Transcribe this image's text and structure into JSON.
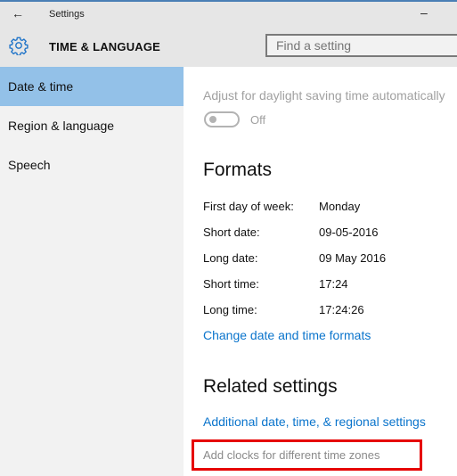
{
  "window": {
    "back_icon": "←",
    "title": "Settings",
    "minimize_icon": "–"
  },
  "header": {
    "section_title": "TIME & LANGUAGE",
    "search_placeholder": "Find a setting",
    "search_value": ""
  },
  "sidebar": {
    "items": [
      {
        "label": "Date & time",
        "active": true
      },
      {
        "label": "Region & language",
        "active": false
      },
      {
        "label": "Speech",
        "active": false
      }
    ]
  },
  "content": {
    "daylight_saving": {
      "label": "Adjust for daylight saving time automatically",
      "state": "Off"
    },
    "formats": {
      "heading": "Formats",
      "rows": [
        {
          "label": "First day of week:",
          "value": "Monday"
        },
        {
          "label": "Short date:",
          "value": "09-05-2016"
        },
        {
          "label": "Long date:",
          "value": "09 May 2016"
        },
        {
          "label": "Short time:",
          "value": "17:24"
        },
        {
          "label": "Long time:",
          "value": "17:24:26"
        }
      ],
      "change_link": "Change date and time formats"
    },
    "related": {
      "heading": "Related settings",
      "links": [
        "Additional date, time, & regional settings",
        "Add clocks for different time zones"
      ]
    }
  },
  "colors": {
    "accent": "#0a74cc",
    "selected_nav": "#93c1e8",
    "highlight_box": "#e60000"
  }
}
